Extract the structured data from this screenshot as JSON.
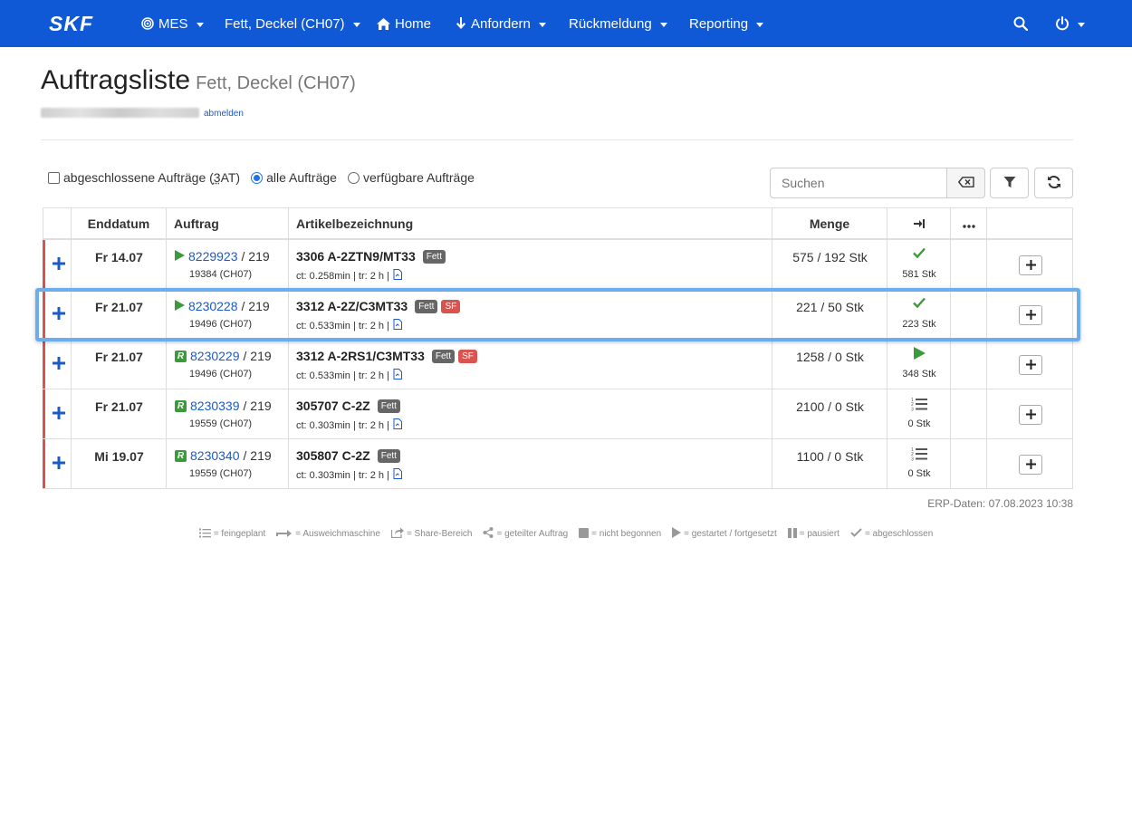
{
  "navbar": {
    "brand": "SKF",
    "menus": [
      {
        "label": "MES",
        "icon": "target-icon"
      },
      {
        "label": "Fett, Deckel (CH07)"
      },
      {
        "label": "Home",
        "icon": "home-icon"
      },
      {
        "label": "Anfordern",
        "icon": "arrow-down-icon"
      },
      {
        "label": "Rückmeldung"
      },
      {
        "label": "Reporting"
      }
    ]
  },
  "header": {
    "title": "Auftragsliste",
    "subtitle": "Fett, Deckel (CH07)",
    "logout": "abmelden"
  },
  "filters": {
    "closed_label": "abgeschlossene Aufträge (",
    "closed_count": "3",
    "closed_suffix": " AT)",
    "all_label": "alle Aufträge",
    "available_label": "verfügbare Aufträge",
    "selected": "alle Aufträge"
  },
  "search": {
    "placeholder": "Suchen"
  },
  "table": {
    "headers": [
      "Enddatum",
      "Auftrag",
      "Artikelbezeichnung",
      "Menge",
      "",
      "",
      ""
    ],
    "rows": [
      {
        "date": "Fr 14.07",
        "order_icon": "play",
        "order": "8229923",
        "order_suffix": " / 219",
        "order_sub": "19384 (CH07)",
        "article": "3306 A-2ZTN9/MT33",
        "badges": [
          "Fett"
        ],
        "article_sub": "ct: 0.258min | tr: 2 h |",
        "qty": "575 / 192 Stk",
        "status": "check",
        "status_count": "581 Stk"
      },
      {
        "date": "Fr 21.07",
        "order_icon": "play",
        "order": "8230228",
        "order_suffix": " / 219",
        "order_sub": "19496 (CH07)",
        "article": "3312 A-2Z/C3MT33",
        "badges": [
          "Fett",
          "SF"
        ],
        "article_sub": "ct: 0.533min | tr: 2 h |",
        "qty": "221 / 50 Stk",
        "status": "check",
        "status_count": "223 Stk"
      },
      {
        "date": "Fr 21.07",
        "order_icon": "R",
        "order": "8230229",
        "order_suffix": " / 219",
        "order_sub": "19496 (CH07)",
        "article": "3312 A-2RS1/C3MT33",
        "badges": [
          "Fett",
          "SF"
        ],
        "article_sub": "ct: 0.533min | tr: 2 h |",
        "qty": "1258 / 0 Stk",
        "status": "play",
        "status_count": "348 Stk"
      },
      {
        "date": "Fr 21.07",
        "order_icon": "R",
        "order": "8230339",
        "order_suffix": " / 219",
        "order_sub": "19559 (CH07)",
        "article": "305707 C-2Z",
        "badges": [
          "Fett"
        ],
        "article_sub": "ct: 0.303min | tr: 2 h |",
        "qty": "2100 / 0 Stk",
        "status": "list",
        "status_count": "0 Stk"
      },
      {
        "date": "Mi 19.07",
        "order_icon": "R",
        "order": "8230340",
        "order_suffix": " / 219",
        "order_sub": "19559 (CH07)",
        "article": "305807 C-2Z",
        "badges": [
          "Fett"
        ],
        "article_sub": "ct: 0.303min | tr: 2 h |",
        "qty": "1100 / 0 Stk",
        "status": "list",
        "status_count": "0 Stk"
      }
    ]
  },
  "erp": "ERP-Daten: 07.08.2023 10:38",
  "legend": [
    {
      "icon": "list-icon",
      "label": "= feingeplant"
    },
    {
      "icon": "redirect-icon",
      "label": "= Ausweichmaschine"
    },
    {
      "icon": "share-icon",
      "label": "= Share-Bereich"
    },
    {
      "icon": "share-nodes-icon",
      "label": "= geteilter Auftrag"
    },
    {
      "icon": "stop-icon",
      "label": "= nicht begonnen"
    },
    {
      "icon": "play-icon",
      "label": "= gestartet / fortgesetzt"
    },
    {
      "icon": "pause-icon",
      "label": "= pausiert"
    },
    {
      "icon": "check-icon",
      "label": "= abgeschlossen"
    }
  ],
  "colors": {
    "navbar": "#0f58d6",
    "link": "#1a5bc6",
    "accent_red": "#d9534f",
    "success": "#3c9a3c",
    "highlight": "#6aaef0"
  }
}
